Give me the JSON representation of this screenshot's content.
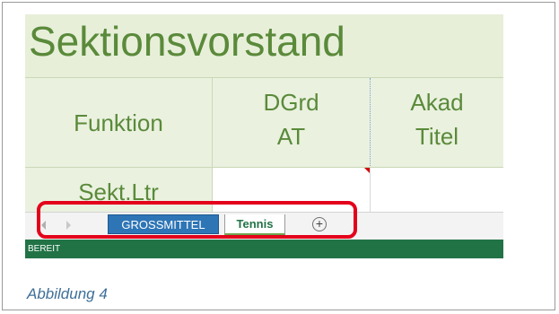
{
  "sheet": {
    "title": "Sektionsvorstand",
    "headers": {
      "funktion": "Funktion",
      "dgrd_line1": "DGrd",
      "dgrd_line2": "AT",
      "akad_line1": "Akad",
      "akad_line2": "Titel"
    },
    "rows": [
      {
        "funktion": "Sekt.Ltr"
      }
    ]
  },
  "tabs": {
    "items": [
      {
        "label": "GROSSMITTEL",
        "active": false
      },
      {
        "label": "Tennis",
        "active": true
      }
    ],
    "add_icon": "plus-circle-icon",
    "nav_icons": [
      "scroll-left-icon",
      "scroll-right-icon"
    ]
  },
  "statusbar": {
    "text": "BEREIT"
  },
  "caption": "Abbildung 4",
  "colors": {
    "title_green": "#5a8a3a",
    "band_green": "#e7efd9",
    "tab_blue": "#2e75b6",
    "excel_green": "#217346",
    "highlight_red": "#e4001b"
  }
}
